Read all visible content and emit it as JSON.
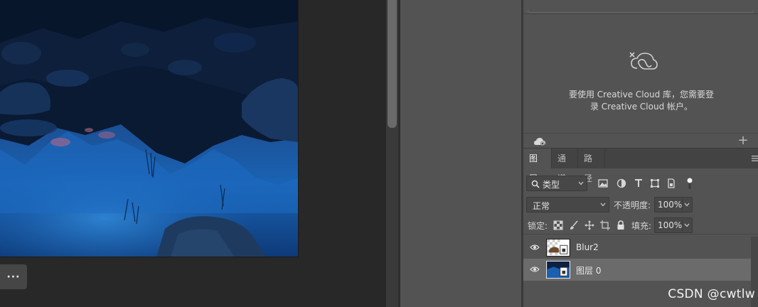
{
  "canvas": {
    "more_label": "···"
  },
  "libraries": {
    "message_line1": "要使用 Creative Cloud 库，您需要登",
    "message_line2": "录 Creative Cloud 帐户。",
    "add_label": "+",
    "cloud_icon": "creative-cloud-icon"
  },
  "layers_panel": {
    "tabs": [
      {
        "label": "图层",
        "active": true
      },
      {
        "label": "通道",
        "active": false
      },
      {
        "label": "路径",
        "active": false
      }
    ],
    "filter": {
      "label": "类型",
      "icons": [
        "image-filter-icon",
        "adjustment-filter-icon",
        "type-filter-icon",
        "shape-filter-icon",
        "smart-object-filter-icon",
        "filter-toggle-icon"
      ]
    },
    "blend_mode": "正常",
    "opacity_label": "不透明度:",
    "opacity_value": "100%",
    "lock_label": "锁定:",
    "lock_icons": [
      "lock-transparent-icon",
      "lock-pixels-icon",
      "lock-position-icon",
      "lock-artboard-icon",
      "lock-all-icon"
    ],
    "fill_label": "填充:",
    "fill_value": "100%",
    "layers": [
      {
        "name": "Blur2",
        "visible": true,
        "selected": false
      },
      {
        "name": "图层 0",
        "visible": true,
        "selected": true
      }
    ]
  },
  "watermark": "CSDN @cwtlw",
  "colors": {
    "canvas_bg": "#282828",
    "panel_bg": "#535353",
    "selected_row": "#6b6b6b",
    "water_blue": "#1a5fae"
  }
}
